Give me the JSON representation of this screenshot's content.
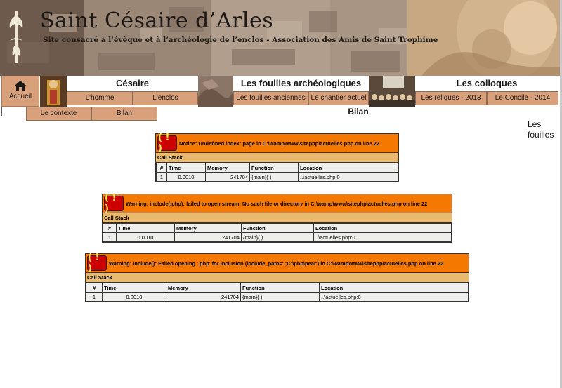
{
  "header": {
    "title": "Saint Césaire d’Arles",
    "subtitle": "Site consacré à  l’évèque et à l’archéologie de l’enclos - Association des Amis de Saint Trophime"
  },
  "nav": {
    "accueil": "Accueil",
    "cesaire": {
      "label": "Césaire",
      "items": [
        "L'homme",
        "L'enclos",
        "Le contexte",
        "Bilan"
      ]
    },
    "fouilles": {
      "label": "Les fouilles archéologiques",
      "items": [
        "Les fouilles anciennes",
        "Le chantier actuel"
      ]
    },
    "colloques": {
      "label": "Les colloques",
      "items": [
        "Les reliques - 2013",
        "Le Concile - 2014"
      ]
    }
  },
  "page": {
    "heading": "Bilan",
    "side_text": "Les fouilles"
  },
  "errors": [
    {
      "icon": "( ! )",
      "message": "Notice: Undefined index: page in C:\\wamp\\www\\sitephp\\actuelles.php on line 22",
      "call_stack_label": "Call Stack",
      "columns": [
        "#",
        "Time",
        "Memory",
        "Function",
        "Location"
      ],
      "row": [
        "1",
        "0.0010",
        "241704",
        "{main}( )",
        "..\\actuelles.php:0"
      ]
    },
    {
      "icon": "( ! )",
      "message": "Warning: include(.php): failed to open stream: No such file or directory in C:\\wamp\\www\\sitephp\\actuelles.php on line 22",
      "call_stack_label": "Call Stack",
      "columns": [
        "#",
        "Time",
        "Memory",
        "Function",
        "Location"
      ],
      "row": [
        "1",
        "0.0010",
        "241704",
        "{main}( )",
        "..\\actuelles.php:0"
      ]
    },
    {
      "icon": "( ! )",
      "message": "Warning: include(): Failed opening '.php' for inclusion (include_path='.;C:\\php\\pear') in C:\\wamp\\www\\sitephp\\actuelles.php on line 22",
      "call_stack_label": "Call Stack",
      "columns": [
        "#",
        "Time",
        "Memory",
        "Function",
        "Location"
      ],
      "row": [
        "1",
        "0.0010",
        "241704",
        "{main}( )",
        "..\\actuelles.php:0"
      ]
    }
  ],
  "colors": {
    "nav_button": "#d9a07c",
    "xdebug_header": "#f57900",
    "xdebug_callstack": "#e9b96e",
    "xdebug_table": "#eeeeec",
    "xdebug_icon": "#cc0000"
  }
}
